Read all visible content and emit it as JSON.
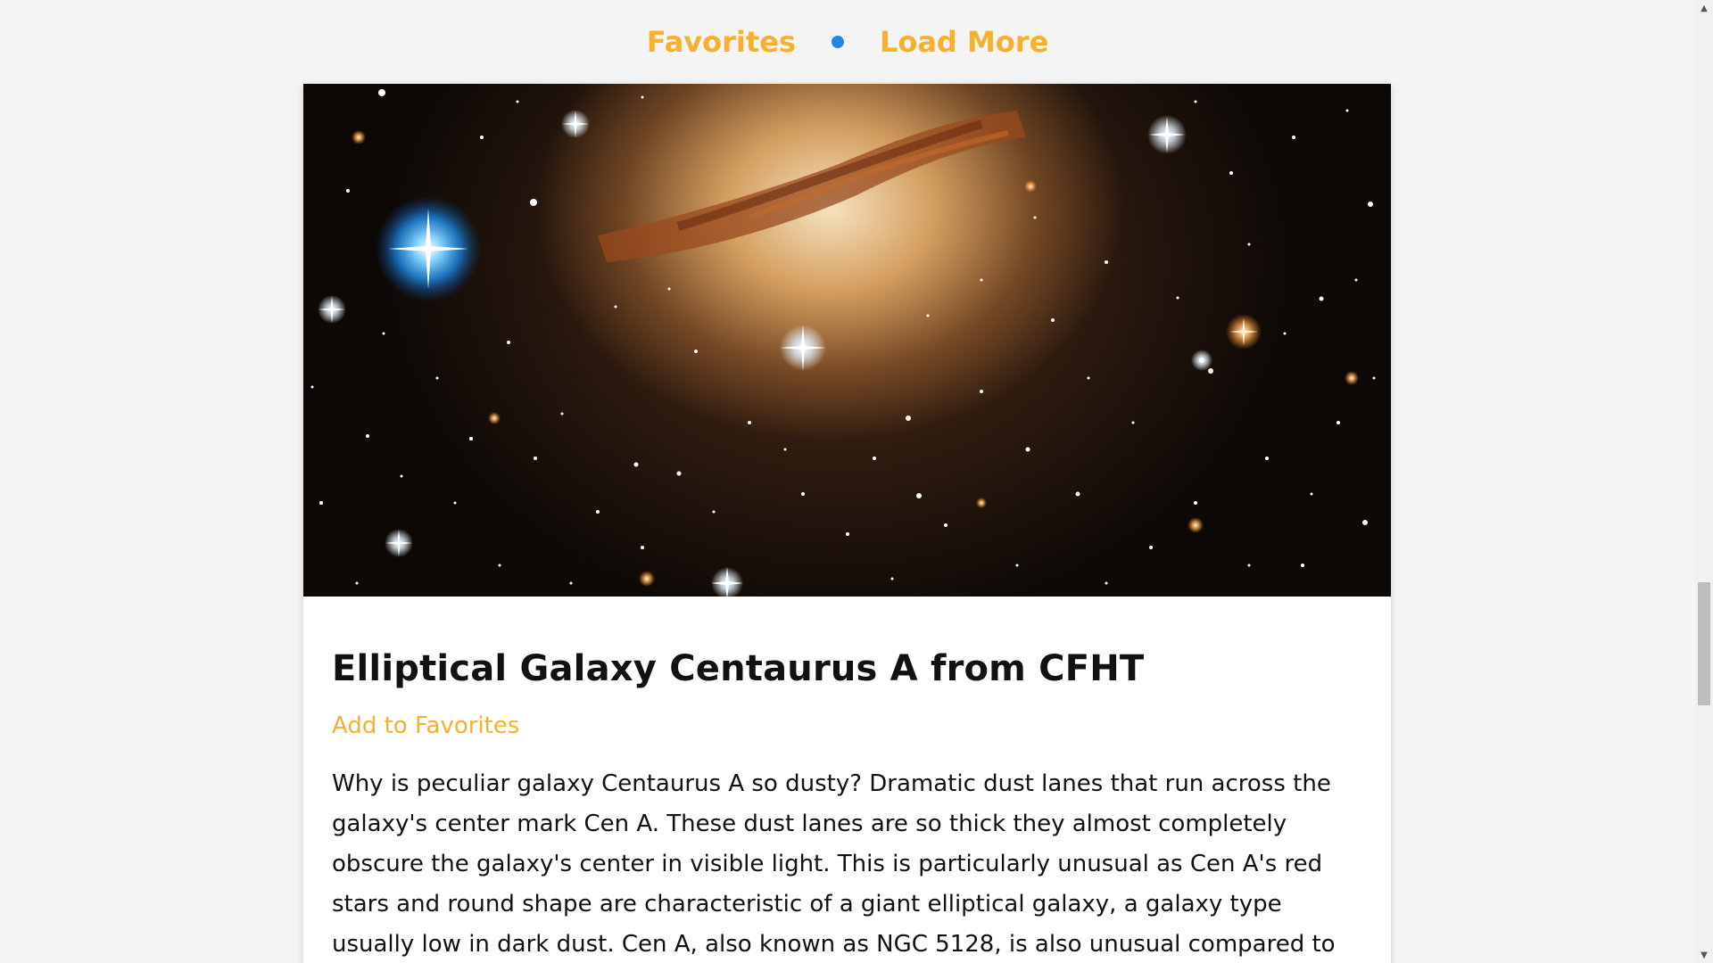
{
  "colors": {
    "accent": "#f5b02c",
    "dot": "#1e88e5"
  },
  "nav": {
    "favorites_label": "Favorites",
    "separator_icon": "dot-icon",
    "load_more_label": "Load More"
  },
  "article": {
    "image_alt": "Elliptical Galaxy Centaurus A from CFHT",
    "title": "Elliptical Galaxy Centaurus A from CFHT",
    "add_favorite_label": "Add to Favorites",
    "description": "Why is peculiar galaxy Centaurus A so dusty? Dramatic dust lanes that run across the galaxy's center mark Cen A. These dust lanes are so thick they almost completely obscure the galaxy's center in visible light. This is particularly unusual as Cen A's red stars and round shape are characteristic of a giant elliptical galaxy, a galaxy type usually low in dark dust. Cen A, also known as NGC 5128, is also unusual compared to an average elliptical"
  },
  "scrollbar": {
    "up_icon": "arrow-up-icon",
    "down_icon": "arrow-down-icon"
  }
}
